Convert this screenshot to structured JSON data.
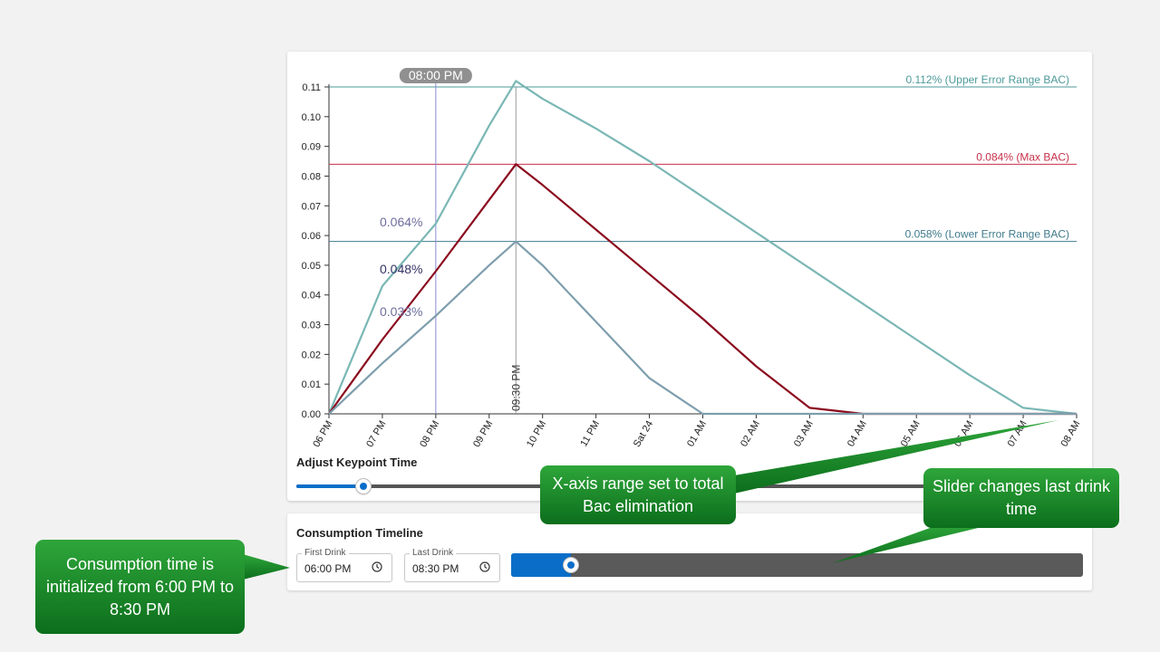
{
  "chart_card": {
    "keypoint_title": "Adjust Keypoint Time",
    "keypoint_slider_value": 0.085
  },
  "chart_data": {
    "type": "line",
    "x": [
      "06 PM",
      "07 PM",
      "08 PM",
      "09 PM",
      "09:30 PM",
      "10 PM",
      "11 PM",
      "Sat 24",
      "01 AM",
      "02 AM",
      "03 AM",
      "04 AM",
      "05 AM",
      "06 AM",
      "07 AM",
      "08 AM"
    ],
    "x_ticks": [
      "06 PM",
      "07 PM",
      "08 PM",
      "09 PM",
      "10 PM",
      "11 PM",
      "Sat 24",
      "01 AM",
      "02 AM",
      "03 AM",
      "04 AM",
      "05 AM",
      "06 AM",
      "07 AM",
      "08 AM"
    ],
    "ylim": [
      0,
      0.11
    ],
    "y_ticks": [
      "0.00",
      "0.01",
      "0.02",
      "0.03",
      "0.04",
      "0.05",
      "0.06",
      "0.07",
      "0.08",
      "0.09",
      "0.10",
      "0.11"
    ],
    "series": [
      {
        "values": [
          0,
          0.043,
          0.064,
          0.097,
          0.112,
          0.106,
          0.096,
          0.085,
          0.073,
          0.061,
          0.049,
          0.037,
          0.025,
          0.013,
          0.002,
          0
        ]
      },
      {
        "values": [
          0,
          0.025,
          0.048,
          0.072,
          0.084,
          0.077,
          0.062,
          0.047,
          0.032,
          0.016,
          0.002,
          0,
          0,
          0,
          0,
          0
        ]
      },
      {
        "values": [
          0,
          0.017,
          0.033,
          0.05,
          0.058,
          0.05,
          0.031,
          0.012,
          0,
          0,
          0,
          0,
          0,
          0,
          0,
          0
        ]
      }
    ],
    "reference_lines": [
      {
        "value": 0.112,
        "label": "0.112% (Upper Error Range BAC)",
        "color": "#4e9a9a"
      },
      {
        "value": 0.084,
        "label": "0.084% (Max BAC)",
        "color": "#c8304a"
      },
      {
        "value": 0.058,
        "label": "0.058% (Lower Error Range BAC)",
        "color": "#3f7a8c"
      }
    ],
    "keypoint": {
      "time_label": "08:00 PM",
      "values": [
        "0.064%",
        "0.048%",
        "0.033%"
      ]
    },
    "peak_marker": {
      "label": "09:30 PM"
    },
    "grid": false
  },
  "colors": {
    "upper": "#7ab7b5",
    "max": "#8b0a1e",
    "lower": "#7e9ead",
    "accent": "#0a6ec9"
  },
  "timeline": {
    "title": "Consumption Timeline",
    "first_drink": {
      "label": "First Drink",
      "value": "06:00 PM",
      "icon": "clock-icon"
    },
    "last_drink": {
      "label": "Last Drink",
      "value": "08:30 PM",
      "icon": "clock-icon"
    },
    "slider_value": 0.105
  },
  "callouts": {
    "consumption": "Consumption time is initialized from 6:00 PM to 8:30 PM",
    "xaxis": "X-axis range set to total Bac elimination",
    "slider": "Slider changes last drink time"
  }
}
